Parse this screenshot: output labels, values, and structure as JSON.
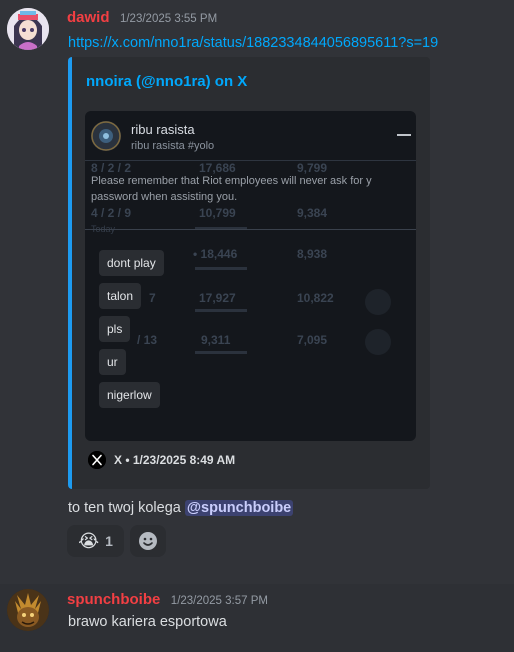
{
  "messages": [
    {
      "username": "dawid",
      "timestamp": "1/23/2025 3:55 PM",
      "link": "https://x.com/nno1ra/status/1882334844056895611?s=19",
      "embed": {
        "author": "nnoira (@nno1ra) on X",
        "footer": "X • 1/23/2025 8:49 AM",
        "image": {
          "profile_name": "ribu rasista",
          "profile_status": "ribu rasista #yolo",
          "notice_line1": "Please remember that Riot employees will never ask for y",
          "notice_line2": "password when assisting you.",
          "chips": [
            "dont play",
            "talon",
            "pls",
            "ur",
            "nigerlow"
          ],
          "background_stats": {
            "row1": [
              "8 / 2 / 2",
              "17,686",
              "9,799"
            ],
            "row2": [
              "4 / 2 / 9",
              "10,799",
              "9,384"
            ],
            "row3": [
              "• 18,446",
              "8,938"
            ],
            "row4": [
              "7",
              "17,927",
              "10,822"
            ],
            "row5": [
              "/ 13",
              "9,311",
              "7,095"
            ],
            "today": "Today"
          }
        }
      },
      "reply_text": "to ten twoj kolega",
      "mention": "@spunchboibe",
      "reactions": [
        {
          "emoji": "😭",
          "count": "1"
        }
      ],
      "add_reaction_icon": "smiley-add-icon"
    },
    {
      "username": "spunchboibe",
      "timestamp": "1/23/2025 3:57 PM",
      "text": "brawo kariera esportowa"
    }
  ],
  "colors": {
    "background": "#313338",
    "username": "#f23f43",
    "link": "#00a8fc",
    "embed_border": "#1d9bf0",
    "mention_bg": "#3c4270"
  }
}
